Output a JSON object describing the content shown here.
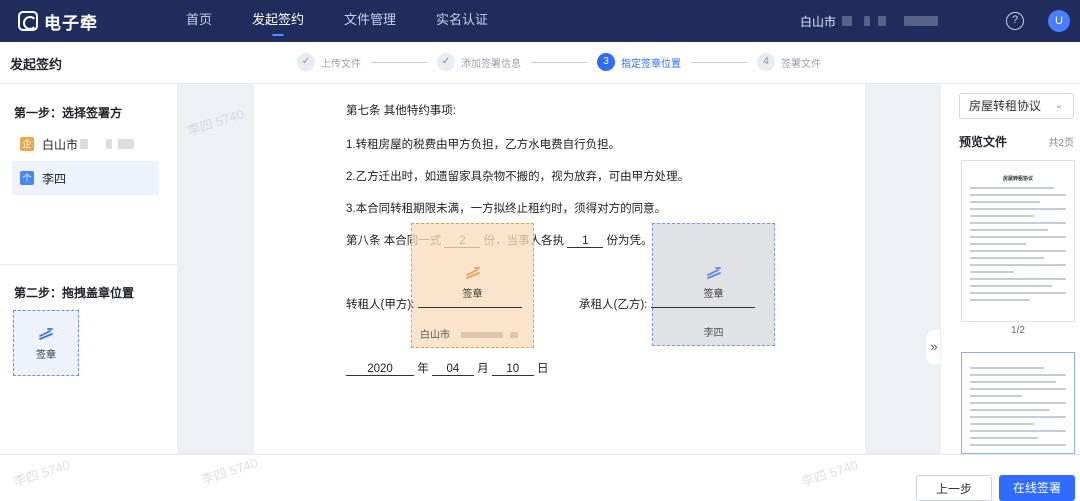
{
  "app": {
    "name": "电子牵"
  },
  "nav": {
    "items": [
      {
        "label": "首页",
        "active": false
      },
      {
        "label": "发起签约",
        "active": true
      },
      {
        "label": "文件管理",
        "active": false
      },
      {
        "label": "实名认证",
        "active": false
      }
    ],
    "org_name": "白山市",
    "help_icon": "question-circle-icon",
    "avatar_initial": "U"
  },
  "header": {
    "title": "发起签约",
    "steps": [
      {
        "number": "1",
        "label": "上传文件",
        "status": "done"
      },
      {
        "number": "2",
        "label": "添加签署信息",
        "status": "done"
      },
      {
        "number": "3",
        "label": "指定签章位置",
        "status": "active"
      },
      {
        "number": "4",
        "label": "签署文件",
        "status": "pending"
      }
    ]
  },
  "left_panel": {
    "step1_title": "第一步：选择签署方",
    "signers": [
      {
        "name": "白山市",
        "icon": "企",
        "icon_color": "#e9a94d",
        "selected": false
      },
      {
        "name": "李四",
        "icon": "个",
        "icon_color": "#4a86f0",
        "selected": true
      }
    ],
    "step2_title": "第二步：拖拽盖章位置",
    "seal_label": "签章"
  },
  "document": {
    "lines": {
      "clause7": "第七条  其他特约事项:",
      "item1": "1.转租房屋的税费由甲方负担，乙方水电费自行负担。",
      "item2": "2.乙方迁出时，如遗留家具杂物不搬的，视为放弃，可由甲方处理。",
      "item3": "3.本合同转租期限未满，一方拟终止租约时，须得对方的同意。",
      "clause8_a": "第八条  本合同一式",
      "clause8_copies": "2",
      "clause8_b": "份，当事人各执",
      "clause8_each": "1",
      "clause8_c": "份为凭。",
      "party_a": "转租人(甲方):",
      "party_b": "承租人(乙方):",
      "year": "2020",
      "year_unit": "年",
      "month": "04",
      "month_unit": "月",
      "day": "10",
      "day_unit": "日"
    },
    "seal_zones": [
      {
        "label": "签章",
        "owner": "白山市",
        "color": "#e3a35a"
      },
      {
        "label": "签章",
        "owner": "李四",
        "color": "#5b82e0"
      }
    ],
    "watermark_text": "李四 5740"
  },
  "right_panel": {
    "doc_select": "房屋转租协议",
    "preview_title": "预览文件",
    "page_count": "共2页",
    "thumb1_title": "房屋转租协议",
    "thumb1_num": "1/2",
    "expand_icon": "»"
  },
  "footer": {
    "prev_label": "上一步",
    "sign_label": "在线签署"
  }
}
